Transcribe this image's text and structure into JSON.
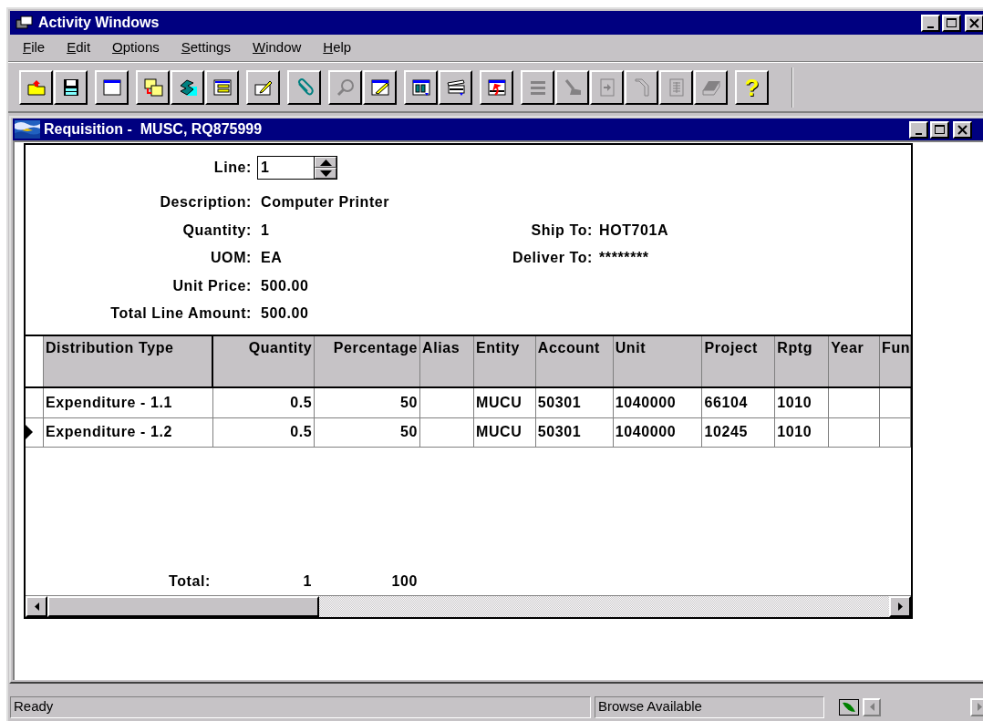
{
  "window": {
    "title": "Activity Windows"
  },
  "menu": [
    "File",
    "Edit",
    "Options",
    "Settings",
    "Window",
    "Help"
  ],
  "toolbar": {
    "groups": [
      [
        {
          "disabled": false
        },
        {
          "disabled": false
        }
      ],
      [
        {
          "disabled": false
        }
      ],
      [
        {
          "disabled": false
        },
        {
          "disabled": false
        },
        {
          "disabled": false
        }
      ],
      [
        {
          "disabled": false
        }
      ],
      [
        {
          "disabled": false
        }
      ],
      [
        {
          "disabled": true
        },
        {
          "disabled": false
        }
      ],
      [
        {
          "disabled": false
        },
        {
          "disabled": false
        }
      ],
      [
        {
          "disabled": false
        }
      ],
      [
        {
          "disabled": true
        },
        {
          "disabled": true
        },
        {
          "disabled": true
        },
        {
          "disabled": true
        },
        {
          "disabled": true
        },
        {
          "disabled": true
        }
      ],
      [
        {
          "disabled": false,
          "glyph": "?"
        }
      ]
    ]
  },
  "child_window": {
    "title": "Requisition -  MUSC, RQ875999"
  },
  "form": {
    "line": {
      "label": "Line:",
      "value": "1"
    },
    "rows": [
      {
        "fields": [
          {
            "label": "Description:",
            "value": "Computer Printer"
          }
        ]
      },
      {
        "fields": [
          {
            "label": "Quantity:",
            "value": "1"
          },
          {
            "label": "Ship To:",
            "value": "HOT701A"
          }
        ]
      },
      {
        "fields": [
          {
            "label": "UOM:",
            "value": "EA"
          },
          {
            "label": "Deliver To:",
            "value": "********"
          }
        ]
      },
      {
        "fields": [
          {
            "label": "Unit Price:",
            "value": "500.00"
          }
        ]
      },
      {
        "fields": [
          {
            "label": "Total Line Amount:",
            "value": "500.00"
          }
        ]
      }
    ]
  },
  "grid": {
    "columns": [
      {
        "label": "Distribution Type"
      },
      {
        "label": "Quantity"
      },
      {
        "label": "Percentage"
      },
      {
        "label": "Alias"
      },
      {
        "label": "Entity"
      },
      {
        "label": "Account"
      },
      {
        "label": "Unit"
      },
      {
        "label": "Project"
      },
      {
        "label": "Rptg"
      },
      {
        "label": "Year"
      },
      {
        "label": "Fun"
      }
    ],
    "rows": [
      {
        "selected": false,
        "cells": [
          "Expenditure - 1.1",
          "0.5",
          "50",
          null,
          "MUCU",
          "50301",
          "1040000",
          "66104",
          "1010",
          null,
          null
        ]
      },
      {
        "selected": true,
        "cells": [
          "Expenditure - 1.2",
          "0.5",
          "50",
          null,
          "MUCU",
          "50301",
          "1040000",
          "10245",
          "1010",
          null,
          null
        ]
      }
    ],
    "totals": {
      "label": "Total:",
      "quantity": "1",
      "percentage": "100"
    }
  },
  "status_bar": [
    "Ready",
    "Browse Available"
  ]
}
